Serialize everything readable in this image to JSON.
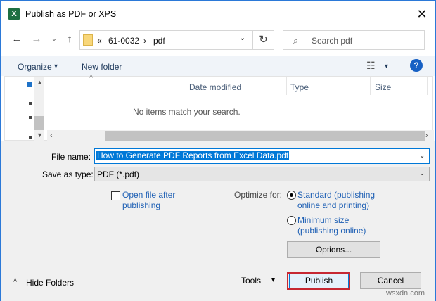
{
  "window": {
    "title": "Publish as PDF or XPS",
    "app_icon": "excel-icon",
    "close_glyph": "✕"
  },
  "nav": {
    "back": "←",
    "forward": "→",
    "up": "↑"
  },
  "address": {
    "prefix": "«",
    "crumb1": "61-0032",
    "sep": "›",
    "crumb2": "pdf",
    "caret": "⌄",
    "refresh": "↻"
  },
  "search": {
    "icon": "⌕",
    "placeholder": "Search pdf"
  },
  "toolbar": {
    "organize": "Organize",
    "organize_caret": "▾",
    "new_folder": "New folder",
    "view_icon": "☷",
    "view_caret": "▾",
    "help": "?"
  },
  "columns": {
    "sort_caret": "^",
    "date_modified": "Date modified",
    "type": "Type",
    "size": "Size"
  },
  "empty_message": "No items match your search.",
  "form": {
    "file_name_label": "File name:",
    "file_name_value": "How to Generate PDF Reports from Excel Data.pdf",
    "save_type_label": "Save as type:",
    "save_type_value": "PDF (*.pdf)",
    "open_after_line1": "Open file after",
    "open_after_line2": "publishing",
    "open_after_checked": false,
    "optimize_label": "Optimize for:",
    "standard_line1": "Standard (publishing",
    "standard_line2": "online and printing)",
    "minimum_line1": "Minimum size",
    "minimum_line2": "(publishing online)",
    "selected_optimization": "standard",
    "options_button": "Options..."
  },
  "footer": {
    "hide_folders_caret": "^",
    "hide_folders": "Hide Folders",
    "tools": "Tools",
    "tools_caret": "▾",
    "publish": "Publish",
    "cancel": "Cancel"
  },
  "watermark": "wsxdn.com",
  "colors": {
    "accent": "#0078d7",
    "link": "#1d5fb4",
    "highlight": "#c62833",
    "excel_green": "#1d6f42"
  }
}
